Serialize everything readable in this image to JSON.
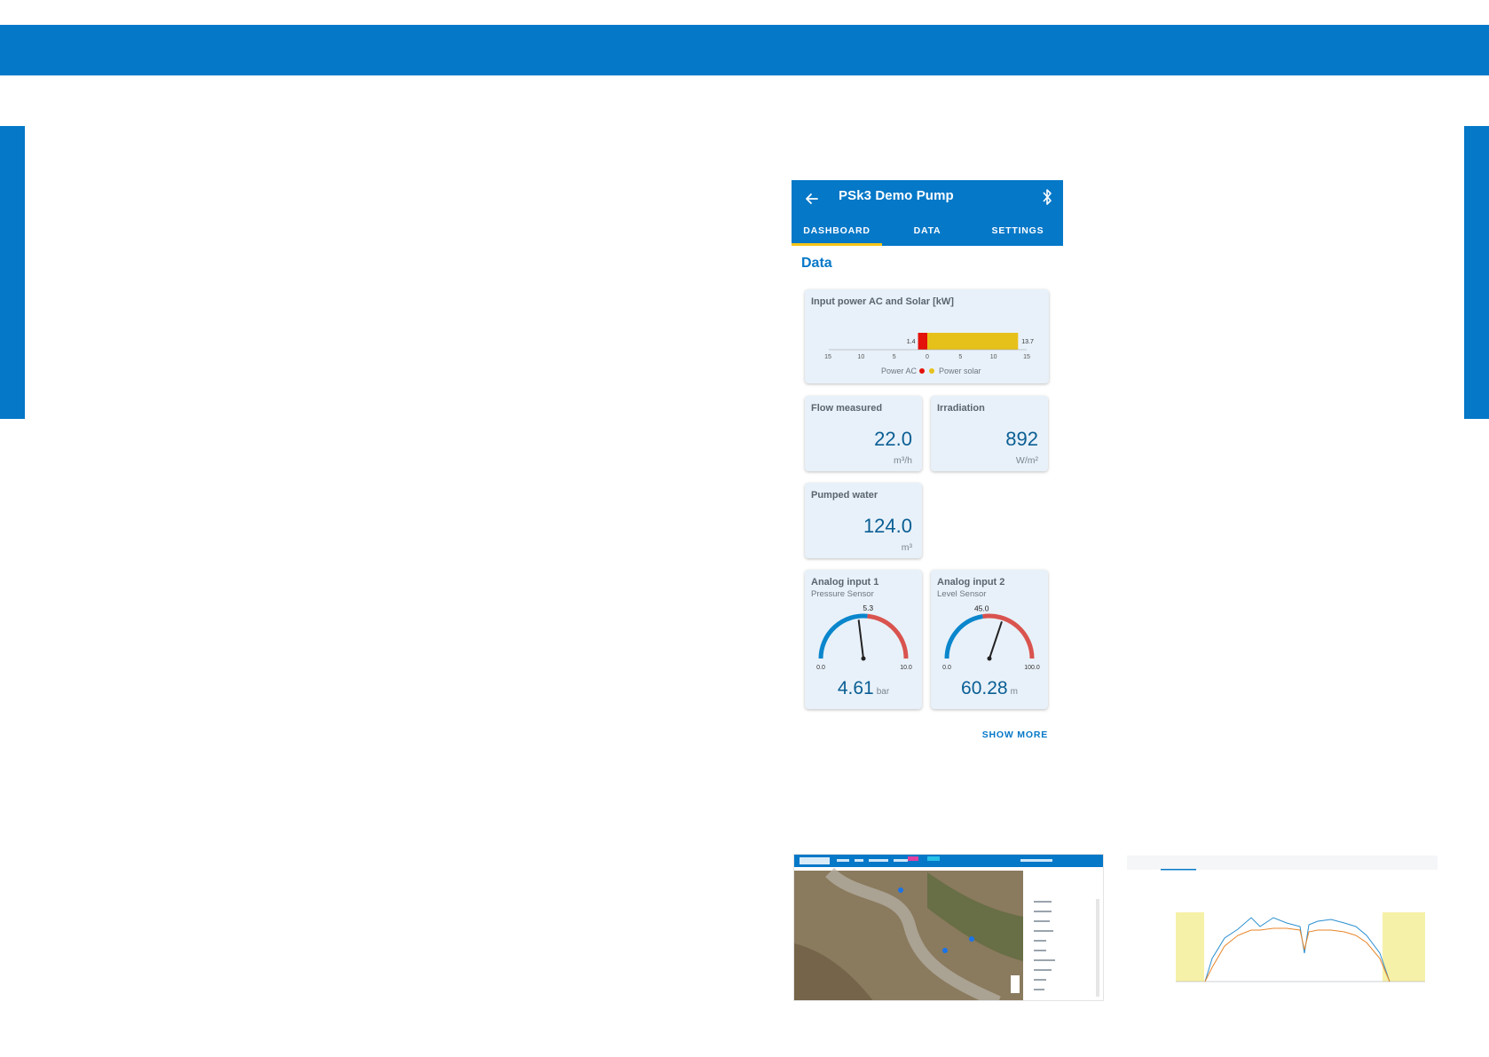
{
  "app": {
    "title": "PSk3 Demo Pump",
    "tabs": [
      "DASHBOARD",
      "DATA",
      "SETTINGS"
    ],
    "active_tab": "DASHBOARD",
    "section_title": "Data",
    "show_more": "SHOW MORE"
  },
  "power": {
    "title": "Input power AC and Solar [kW]",
    "ac_label": "1.4",
    "solar_label": "13.7",
    "ac_value": 1.4,
    "solar_value": 13.7,
    "ticks": [
      "15",
      "10",
      "5",
      "0",
      "5",
      "10",
      "15"
    ],
    "legend_ac": "Power AC",
    "legend_solar": "Power solar",
    "ac_color": "#e3120b",
    "solar_color": "#e6c11a"
  },
  "flow": {
    "title": "Flow measured",
    "value": "22.0",
    "unit": "m³/h"
  },
  "irradiation": {
    "title": "Irradiation",
    "value": "892",
    "unit": "W/m²"
  },
  "pumped": {
    "title": "Pumped water",
    "value": "124.0",
    "unit": "m³"
  },
  "analog1": {
    "title": "Analog input 1",
    "subtitle": "Pressure Sensor",
    "min": "0.0",
    "max": "10.0",
    "marker": "5.3",
    "value": "4.61",
    "unit": "bar",
    "value_num": 4.61,
    "marker_num": 5.3,
    "range_max": 10
  },
  "analog2": {
    "title": "Analog input 2",
    "subtitle": "Level Sensor",
    "min": "0.0",
    "max": "100.0",
    "marker": "45.0",
    "value": "60.28",
    "unit": "m",
    "value_num": 60.28,
    "marker_num": 45.0,
    "range_max": 100
  },
  "colors": {
    "brand": "#0578c8",
    "gauge_blue": "#0a86cc",
    "gauge_red": "#d9534f",
    "tab_indicator": "#f5c518"
  }
}
